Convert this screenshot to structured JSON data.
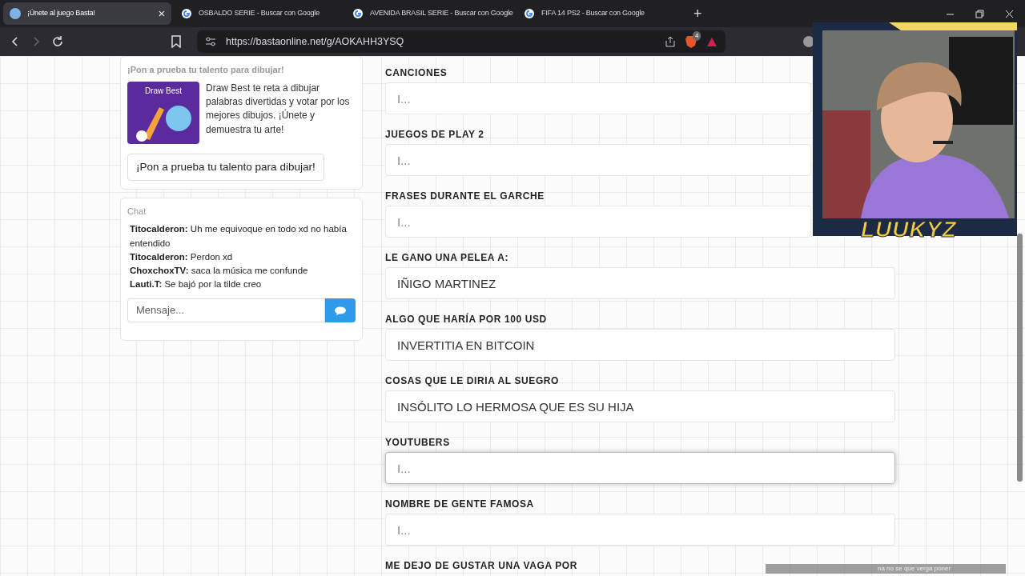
{
  "tabs": [
    {
      "title": "¡Únete al juego Basta!",
      "selected": true,
      "close": "×"
    },
    {
      "title": "OSBALDO SERIE - Buscar con Google",
      "selected": false
    },
    {
      "title": "AVENIDA BRASIL SERIE - Buscar con Google",
      "selected": false
    },
    {
      "title": "FIFA 14 PS2 - Buscar con Google",
      "selected": false
    }
  ],
  "new_tab": "+",
  "toolbar": {
    "url": "https://bastaonline.net/g/AOKAHH3YSQ",
    "forward_disabled": true,
    "shields_badge": "4"
  },
  "promo": {
    "heading": "¡Pon a prueba tu talento para dibujar!",
    "image_title": "Draw Best",
    "description": "Draw Best te reta a dibujar palabras divertidas y votar por los mejores dibujos. ¡Únete y demuestra tu arte!",
    "button": "¡Pon a prueba tu talento para dibujar!"
  },
  "chat": {
    "heading": "Chat",
    "messages": [
      {
        "user": "Titocalderon:",
        "text": "Uh me equivoque en todo xd no había entendido"
      },
      {
        "user": "Titocalderon:",
        "text": "Perdon xd"
      },
      {
        "user": "ChoxchoxTV:",
        "text": "saca la música me confunde"
      },
      {
        "user": "Lauti.T:",
        "text": "Se bajó por la tilde creo"
      }
    ],
    "placeholder": "Mensaje..."
  },
  "categories": [
    {
      "label": "CANCIONES",
      "placeholder": "I...",
      "focused": false
    },
    {
      "label": "JUEGOS DE PLAY 2",
      "placeholder": "I...",
      "focused": false
    },
    {
      "label": "FRASES DURANTE EL GARCHE",
      "placeholder": "I...",
      "focused": false
    },
    {
      "label": "LE GANO UNA PELEA A:",
      "value": "IÑIGO MARTINEZ",
      "focused": false
    },
    {
      "label": "ALGO QUE HARÍA POR 100 USD",
      "value": "INVERTITIA EN BITCOIN",
      "focused": false
    },
    {
      "label": "COSAS QUE LE DIRIA AL SUEGRO",
      "value": "INSÓLITO LO HERMOSA QUE ES SU HIJA",
      "focused": false
    },
    {
      "label": "YOUTUBERS",
      "placeholder": "I...",
      "focused": true
    },
    {
      "label": "NOMBRE DE GENTE FAMOSA",
      "placeholder": "I...",
      "focused": false
    },
    {
      "label": "ME DEJO DE GUSTAR UNA VAGA POR"
    }
  ],
  "stream_overlay": {
    "name": "LUUKYZ",
    "chat_message": "na no se que verga poner"
  }
}
